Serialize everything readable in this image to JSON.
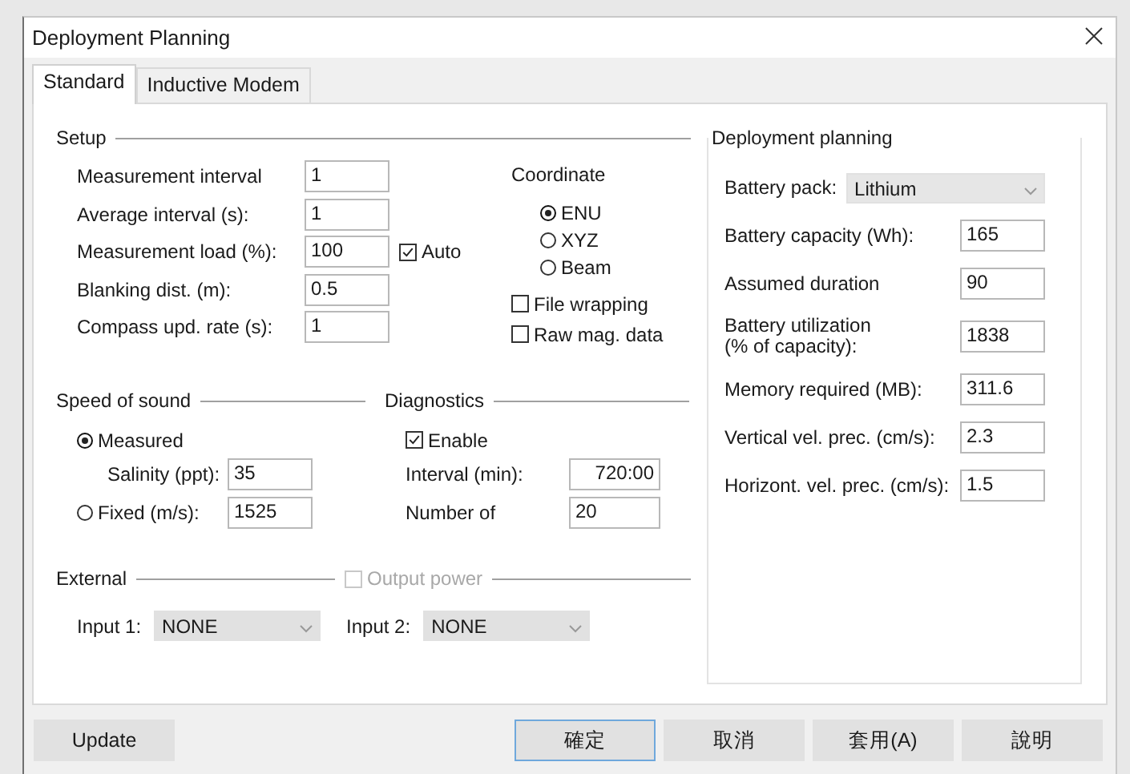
{
  "window": {
    "title": "Deployment Planning"
  },
  "tabs": [
    {
      "label": "Standard",
      "selected": true
    },
    {
      "label": "Inductive Modem",
      "selected": false
    }
  ],
  "setup": {
    "title": "Setup",
    "fields": [
      {
        "label": "Measurement interval",
        "value": "1"
      },
      {
        "label": "Average interval (s):",
        "value": "1"
      },
      {
        "label": "Measurement load (%):",
        "value": "100"
      },
      {
        "label": "Blanking dist. (m):",
        "value": "0.5"
      },
      {
        "label": "Compass upd. rate (s):",
        "value": "1"
      }
    ],
    "auto": {
      "label": "Auto",
      "checked": true
    },
    "coordinate": {
      "title": "Coordinate",
      "options": [
        {
          "label": "ENU",
          "selected": true
        },
        {
          "label": "XYZ",
          "selected": false
        },
        {
          "label": "Beam",
          "selected": false
        }
      ]
    },
    "options": [
      {
        "label": "File wrapping",
        "checked": false
      },
      {
        "label": "Raw mag. data",
        "checked": false
      }
    ]
  },
  "speed_of_sound": {
    "title": "Speed of sound",
    "measured": {
      "label": "Measured",
      "selected": true
    },
    "salinity": {
      "label": "Salinity (ppt):",
      "value": "35"
    },
    "fixed": {
      "label": "Fixed (m/s):",
      "selected": false,
      "value": "1525"
    }
  },
  "diagnostics": {
    "title": "Diagnostics",
    "enable": {
      "label": "Enable",
      "checked": true
    },
    "fields": [
      {
        "label": "Interval (min):",
        "value": "720:00"
      },
      {
        "label": "Number of",
        "value": "20"
      }
    ]
  },
  "external": {
    "title": "External",
    "output_power": {
      "label": "Output power",
      "checked": false,
      "disabled": true
    },
    "inputs": [
      {
        "label": "Input 1:",
        "value": "NONE"
      },
      {
        "label": "Input 2:",
        "value": "NONE"
      }
    ]
  },
  "deployment_planning": {
    "title": "Deployment planning",
    "battery_pack": {
      "label": "Battery pack:",
      "value": "Lithium"
    },
    "fields": [
      {
        "label": "Battery capacity (Wh):",
        "value": "165"
      },
      {
        "label": "Assumed duration",
        "value": "90"
      },
      {
        "label": "Battery utilization\n(% of capacity):",
        "value": "1838"
      },
      {
        "label": "Memory required (MB):",
        "value": "311.6"
      },
      {
        "label": "Vertical vel. prec. (cm/s):",
        "value": "2.3"
      },
      {
        "label": "Horizont. vel. prec. (cm/s):",
        "value": "1.5"
      }
    ]
  },
  "update_button": "Update",
  "buttons": [
    {
      "label": "確定",
      "default": true
    },
    {
      "label": "取消",
      "default": false
    },
    {
      "label": "套用(A)",
      "default": false
    },
    {
      "label": "說明",
      "default": false
    }
  ]
}
